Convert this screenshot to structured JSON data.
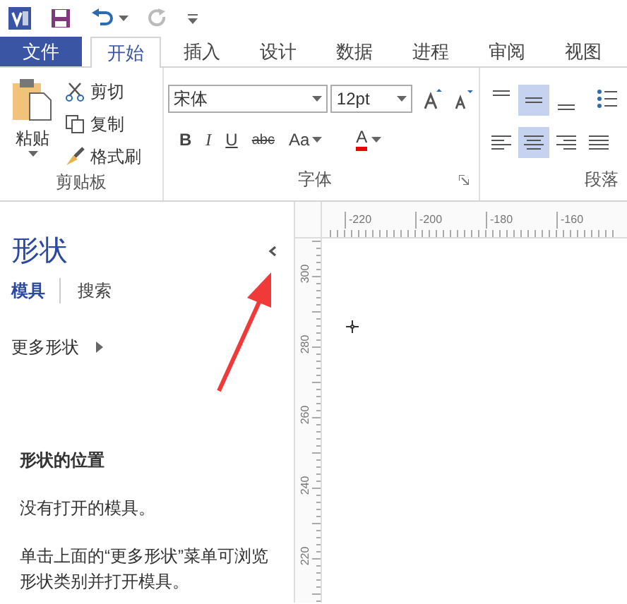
{
  "tabs": [
    {
      "label": "文件",
      "kind": "file",
      "selected": false
    },
    {
      "label": "开始",
      "kind": "tab",
      "selected": true
    },
    {
      "label": "插入",
      "kind": "tab",
      "selected": false
    },
    {
      "label": "设计",
      "kind": "tab",
      "selected": false
    },
    {
      "label": "数据",
      "kind": "tab",
      "selected": false
    },
    {
      "label": "进程",
      "kind": "tab",
      "selected": false
    },
    {
      "label": "审阅",
      "kind": "tab",
      "selected": false
    },
    {
      "label": "视图",
      "kind": "tab",
      "selected": false
    }
  ],
  "clipboard": {
    "paste": "粘贴",
    "cut": "剪切",
    "copy": "复制",
    "format_painter": "格式刷",
    "group_label": "剪贴板"
  },
  "font": {
    "font_name": "宋体",
    "font_size": "12pt",
    "bold": "B",
    "italic": "I",
    "underline": "U",
    "strikethrough": "abc",
    "change_case": "Aa",
    "font_color": "A",
    "group_label": "字体"
  },
  "paragraph": {
    "group_label": "段落",
    "vertical_align": [
      {
        "selected": false
      },
      {
        "selected": true
      },
      {
        "selected": false
      }
    ],
    "horizontal_align": [
      {
        "selected": false
      },
      {
        "selected": true
      },
      {
        "selected": false
      },
      {
        "selected": false
      }
    ]
  },
  "shapes_panel": {
    "title": "形状",
    "tabs": [
      {
        "label": "模具",
        "selected": true
      },
      {
        "label": "搜索",
        "selected": false
      }
    ],
    "more_shapes": "更多形状",
    "heading": "形状的位置",
    "message": "没有打开的模具。",
    "hint": "单击上面的“更多形状”菜单可浏览形状类别并打开模具。"
  },
  "ruler": {
    "horizontal": [
      "-220",
      "-200",
      "-180",
      "-160"
    ],
    "vertical": [
      "300",
      "280",
      "260",
      "240",
      "220"
    ]
  }
}
